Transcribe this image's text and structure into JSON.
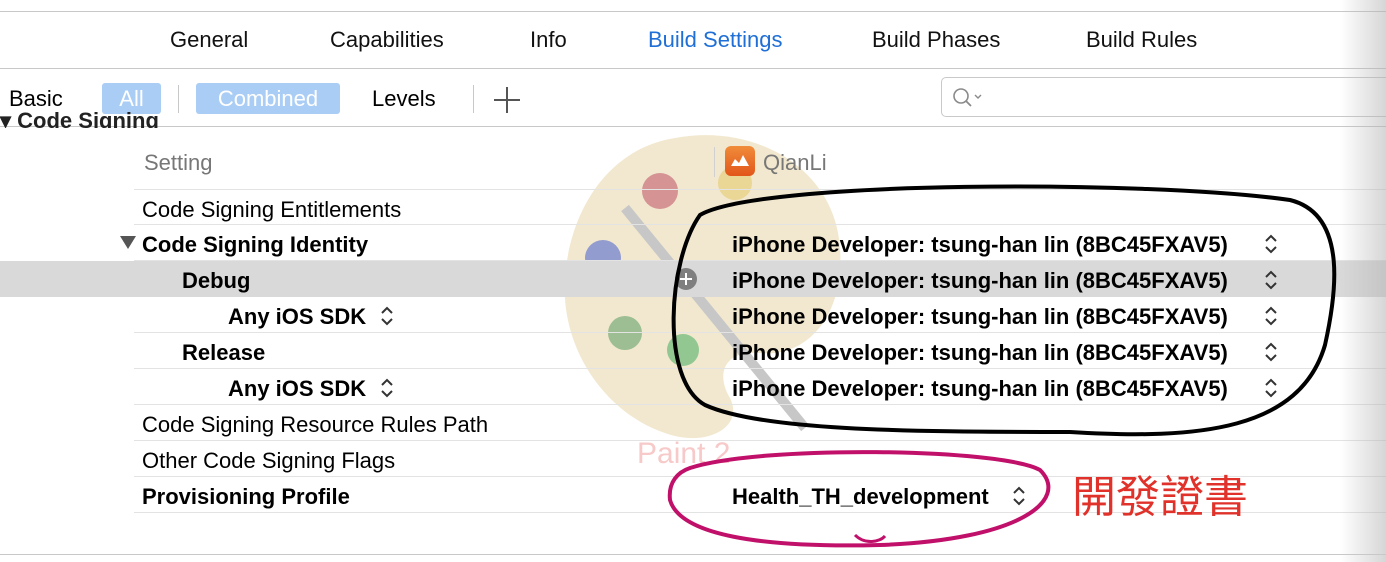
{
  "tabs": [
    "General",
    "Capabilities",
    "Info",
    "Build Settings",
    "Build Phases",
    "Build Rules"
  ],
  "active_tab": "Build Settings",
  "filter": {
    "basic": "Basic",
    "all": "All",
    "combined": "Combined",
    "levels": "Levels",
    "add": "+",
    "search_placeholder": ""
  },
  "section": {
    "title": "Code Signing"
  },
  "columns": {
    "setting": "Setting",
    "target": "QianLi"
  },
  "rows": {
    "entitlements": {
      "label": "Code Signing Entitlements",
      "value": ""
    },
    "identity": {
      "label": "Code Signing Identity",
      "value": "iPhone Developer: tsung-han lin (8BC45FXAV5)"
    },
    "debug": {
      "label": "Debug",
      "value": "iPhone Developer: tsung-han lin (8BC45FXAV5)"
    },
    "debug_sdk": {
      "label": "Any iOS SDK",
      "value": "iPhone Developer: tsung-han lin (8BC45FXAV5)"
    },
    "release": {
      "label": "Release",
      "value": "iPhone Developer: tsung-han lin (8BC45FXAV5)"
    },
    "release_sdk": {
      "label": "Any iOS SDK",
      "value": "iPhone Developer: tsung-han lin (8BC45FXAV5)"
    },
    "resource_rules": {
      "label": "Code Signing Resource Rules Path",
      "value": ""
    },
    "other_flags": {
      "label": "Other Code Signing Flags",
      "value": ""
    },
    "provisioning": {
      "label": "Provisioning Profile",
      "value": "Health_TH_development"
    }
  },
  "watermark": {
    "text": "Paint 2"
  },
  "annotation": {
    "text": "開發證書",
    "color": "#e0322a",
    "circle_colors": [
      "#000000",
      "#c0106a"
    ]
  },
  "colors": {
    "accent": "#1f6fd6",
    "pill": "#aacdf5",
    "selected_row": "#d9d9d9"
  }
}
